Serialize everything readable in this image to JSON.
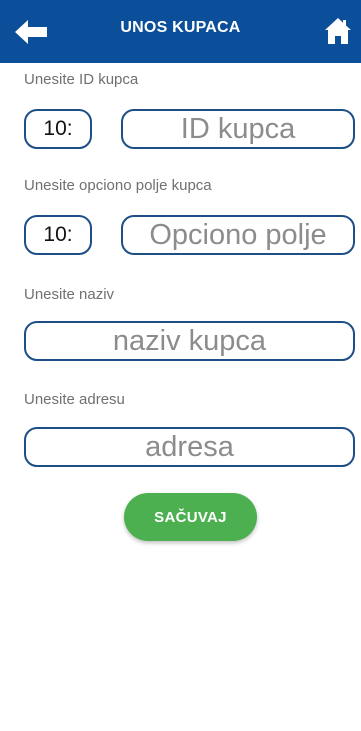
{
  "header": {
    "title": "UNOS KUPACA",
    "back_icon": "arrow-left-icon",
    "home_icon": "home-icon",
    "color": "#0b4f9a"
  },
  "fields": {
    "id": {
      "label": "Unesite ID kupca",
      "prefix": "10:",
      "placeholder": "ID kupca"
    },
    "optional": {
      "label": "Unesite opciono polje kupca",
      "prefix": "10:",
      "placeholder": "Opciono polje"
    },
    "name": {
      "label": "Unesite naziv",
      "placeholder": "naziv kupca"
    },
    "address": {
      "label": "Unesite adresu",
      "placeholder": "adresa"
    }
  },
  "actions": {
    "save_label": "SAČUVAJ",
    "save_color": "#4caf50"
  }
}
